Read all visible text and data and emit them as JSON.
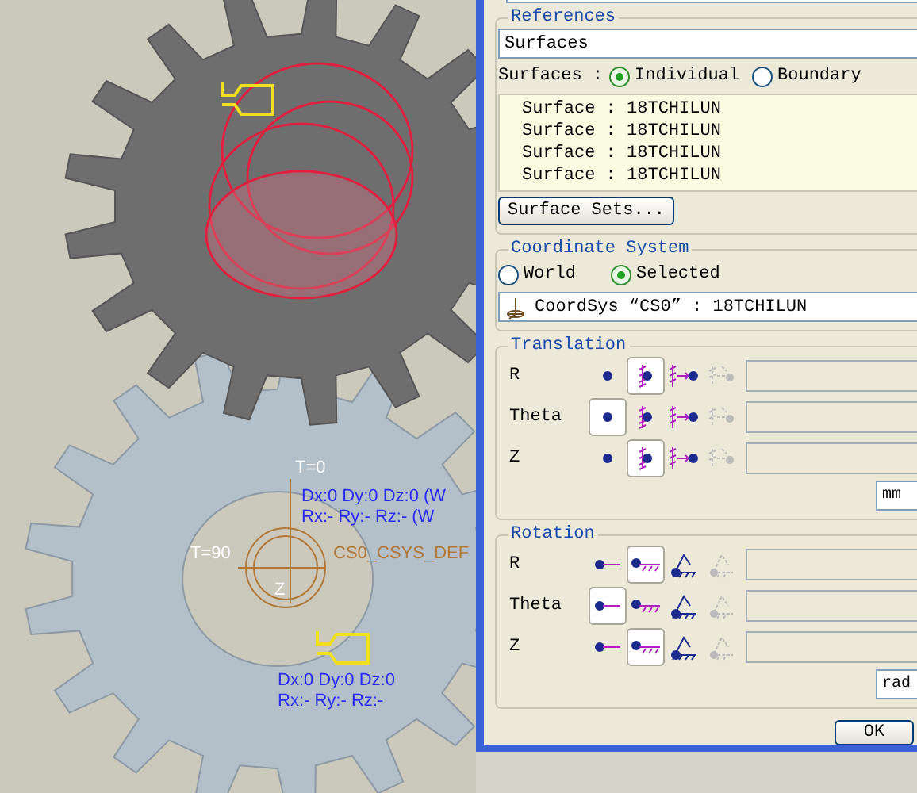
{
  "viewport": {
    "labels": [
      "T=0",
      "Dx:0 Dy:0 Dz:0 (W",
      "Rx:- Ry:- Rz:- (W",
      "T=90",
      "CS0_CSYS_DEF",
      "Z",
      "Dx:0 Dy:0 Dz:0",
      "Rx:- Ry:- Rz:-"
    ]
  },
  "references": {
    "title": "References",
    "field": "Surfaces",
    "mode_label": "Surfaces :",
    "modes": [
      {
        "label": "Individual",
        "selected": true
      },
      {
        "label": "Boundary",
        "selected": false
      }
    ],
    "items": [
      "Surface : 18TCHILUN",
      "Surface : 18TCHILUN",
      "Surface : 18TCHILUN",
      "Surface : 18TCHILUN"
    ],
    "button": "Surface Sets..."
  },
  "coordinate_system": {
    "title": "Coordinate System",
    "options": [
      {
        "label": "World",
        "selected": false
      },
      {
        "label": "Selected",
        "selected": true
      }
    ],
    "field": "CoordSys “CS0” : 18TCHILUN"
  },
  "translation": {
    "title": "Translation",
    "rows": [
      {
        "label": "R",
        "options": [
          {
            "selected": false,
            "disabled": false
          },
          {
            "selected": true,
            "disabled": false
          },
          {
            "selected": false,
            "disabled": false
          },
          {
            "selected": false,
            "disabled": true
          }
        ]
      },
      {
        "label": "Theta",
        "options": [
          {
            "selected": true,
            "disabled": false
          },
          {
            "selected": false,
            "disabled": false
          },
          {
            "selected": false,
            "disabled": false
          },
          {
            "selected": false,
            "disabled": true
          }
        ]
      },
      {
        "label": "Z",
        "options": [
          {
            "selected": false,
            "disabled": false
          },
          {
            "selected": true,
            "disabled": false
          },
          {
            "selected": false,
            "disabled": false
          },
          {
            "selected": false,
            "disabled": true
          }
        ]
      }
    ],
    "unit": "mm"
  },
  "rotation": {
    "title": "Rotation",
    "rows": [
      {
        "label": "R",
        "options": [
          {
            "selected": false,
            "disabled": false
          },
          {
            "selected": true,
            "disabled": false
          },
          {
            "selected": false,
            "disabled": false
          },
          {
            "selected": false,
            "disabled": true
          }
        ]
      },
      {
        "label": "Theta",
        "options": [
          {
            "selected": true,
            "disabled": false
          },
          {
            "selected": false,
            "disabled": false
          },
          {
            "selected": false,
            "disabled": false
          },
          {
            "selected": false,
            "disabled": true
          }
        ]
      },
      {
        "label": "Z",
        "options": [
          {
            "selected": false,
            "disabled": false
          },
          {
            "selected": true,
            "disabled": false
          },
          {
            "selected": false,
            "disabled": false
          },
          {
            "selected": false,
            "disabled": true
          }
        ]
      }
    ],
    "unit": "rad"
  },
  "ok_button": "OK"
}
